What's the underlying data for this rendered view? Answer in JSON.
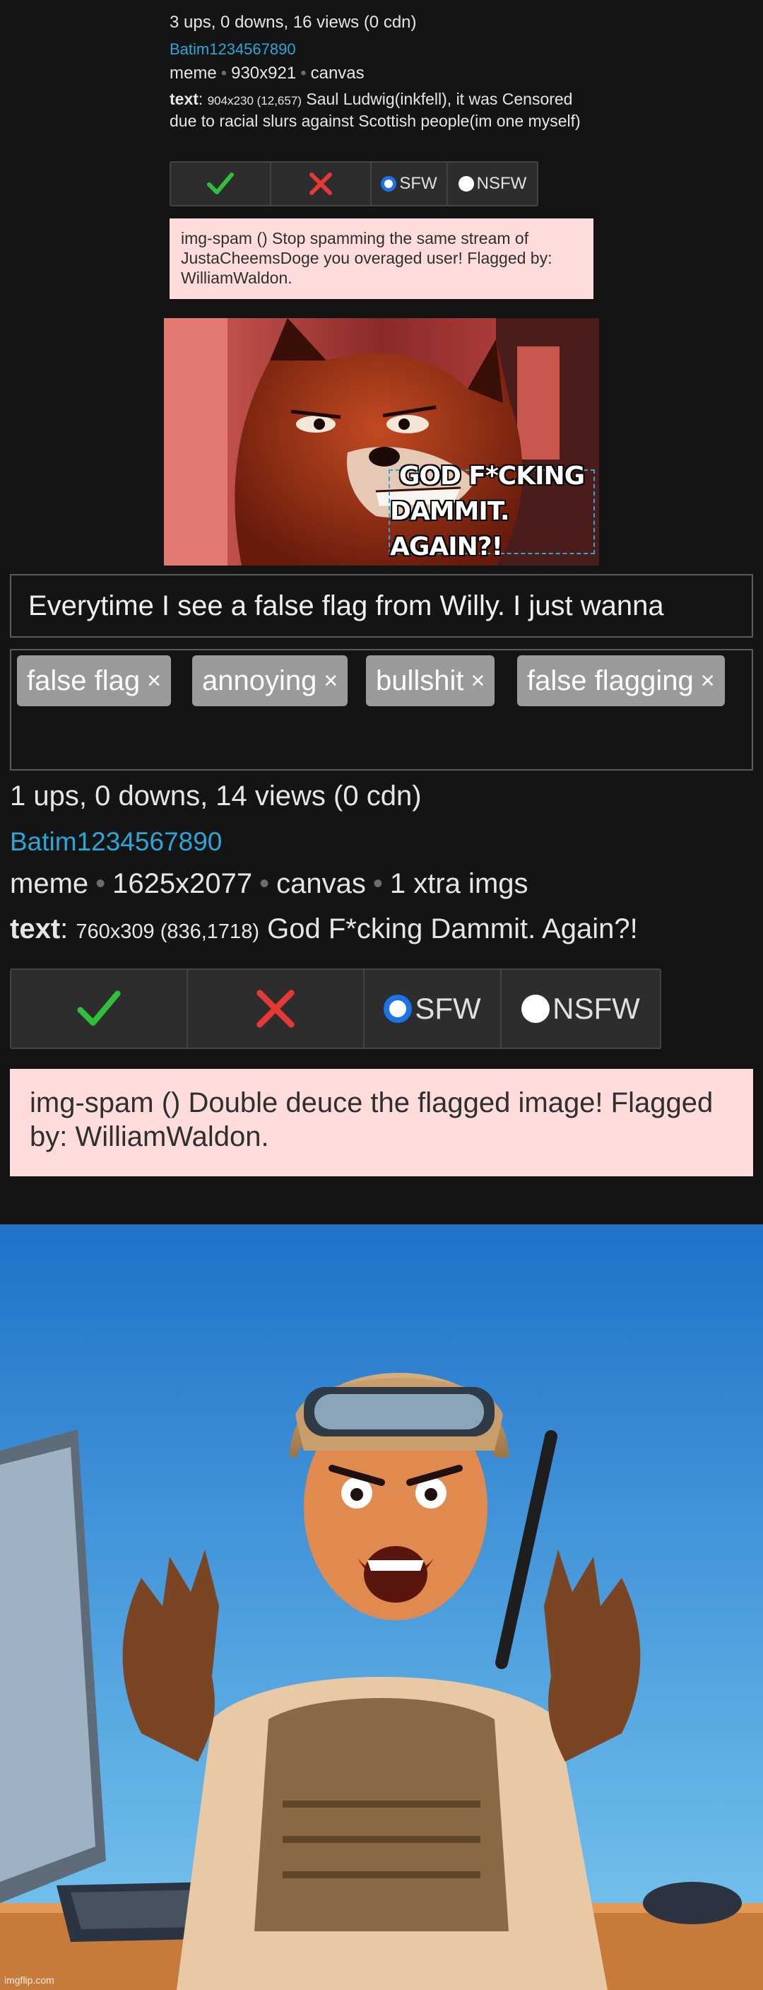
{
  "top_post": {
    "stats": "3 ups, 0 downs, 16 views (0 cdn)",
    "username": "Batim1234567890",
    "type": "meme",
    "dimensions": "930x921",
    "mode": "canvas",
    "text_label": "text",
    "text_dims": "904x230 (12,657)",
    "text_value": "Saul Ludwig(inkfell), it was Censored due to racial slurs against Scottish people(im one myself)",
    "sfw_label": "SFW",
    "nsfw_label": "NSFW",
    "flag_message": "img-spam () Stop spamming the same stream of JustaCheemsDoge you overaged user! Flagged by: WilliamWaldon."
  },
  "meme1": {
    "caption_line1": "GOD F*CKING",
    "caption_line2": "DAMMIT. AGAIN?!"
  },
  "editor": {
    "title_value": "Everytime I see a false flag from Willy. I just wanna",
    "tags": [
      {
        "label": "false flag",
        "remove": "×"
      },
      {
        "label": "annoying",
        "remove": "×"
      },
      {
        "label": "bullshit",
        "remove": "×"
      },
      {
        "label": "false flagging",
        "remove": "×"
      }
    ]
  },
  "main_post": {
    "stats": "1 ups, 0 downs, 14 views (0 cdn)",
    "username": "Batim1234567890",
    "type": "meme",
    "dimensions": "1625x2077",
    "mode": "canvas",
    "extra": "1 xtra imgs",
    "text_label": "text",
    "text_dims": "760x309 (836,1718)",
    "text_value": "God F*cking Dammit. Again?!",
    "sfw_label": "SFW",
    "nsfw_label": "NSFW",
    "selected_rating": "SFW",
    "flag_message": "img-spam () Double deuce the flagged image! Flagged by: WilliamWaldon."
  },
  "watermark": "imgflip.com",
  "colors": {
    "background": "#141414",
    "link": "#2aa6d9",
    "approve": "#2fbf3a",
    "reject": "#e53935",
    "flag_bg": "#ffdcdc",
    "tag_bg": "#9a9a9a"
  }
}
